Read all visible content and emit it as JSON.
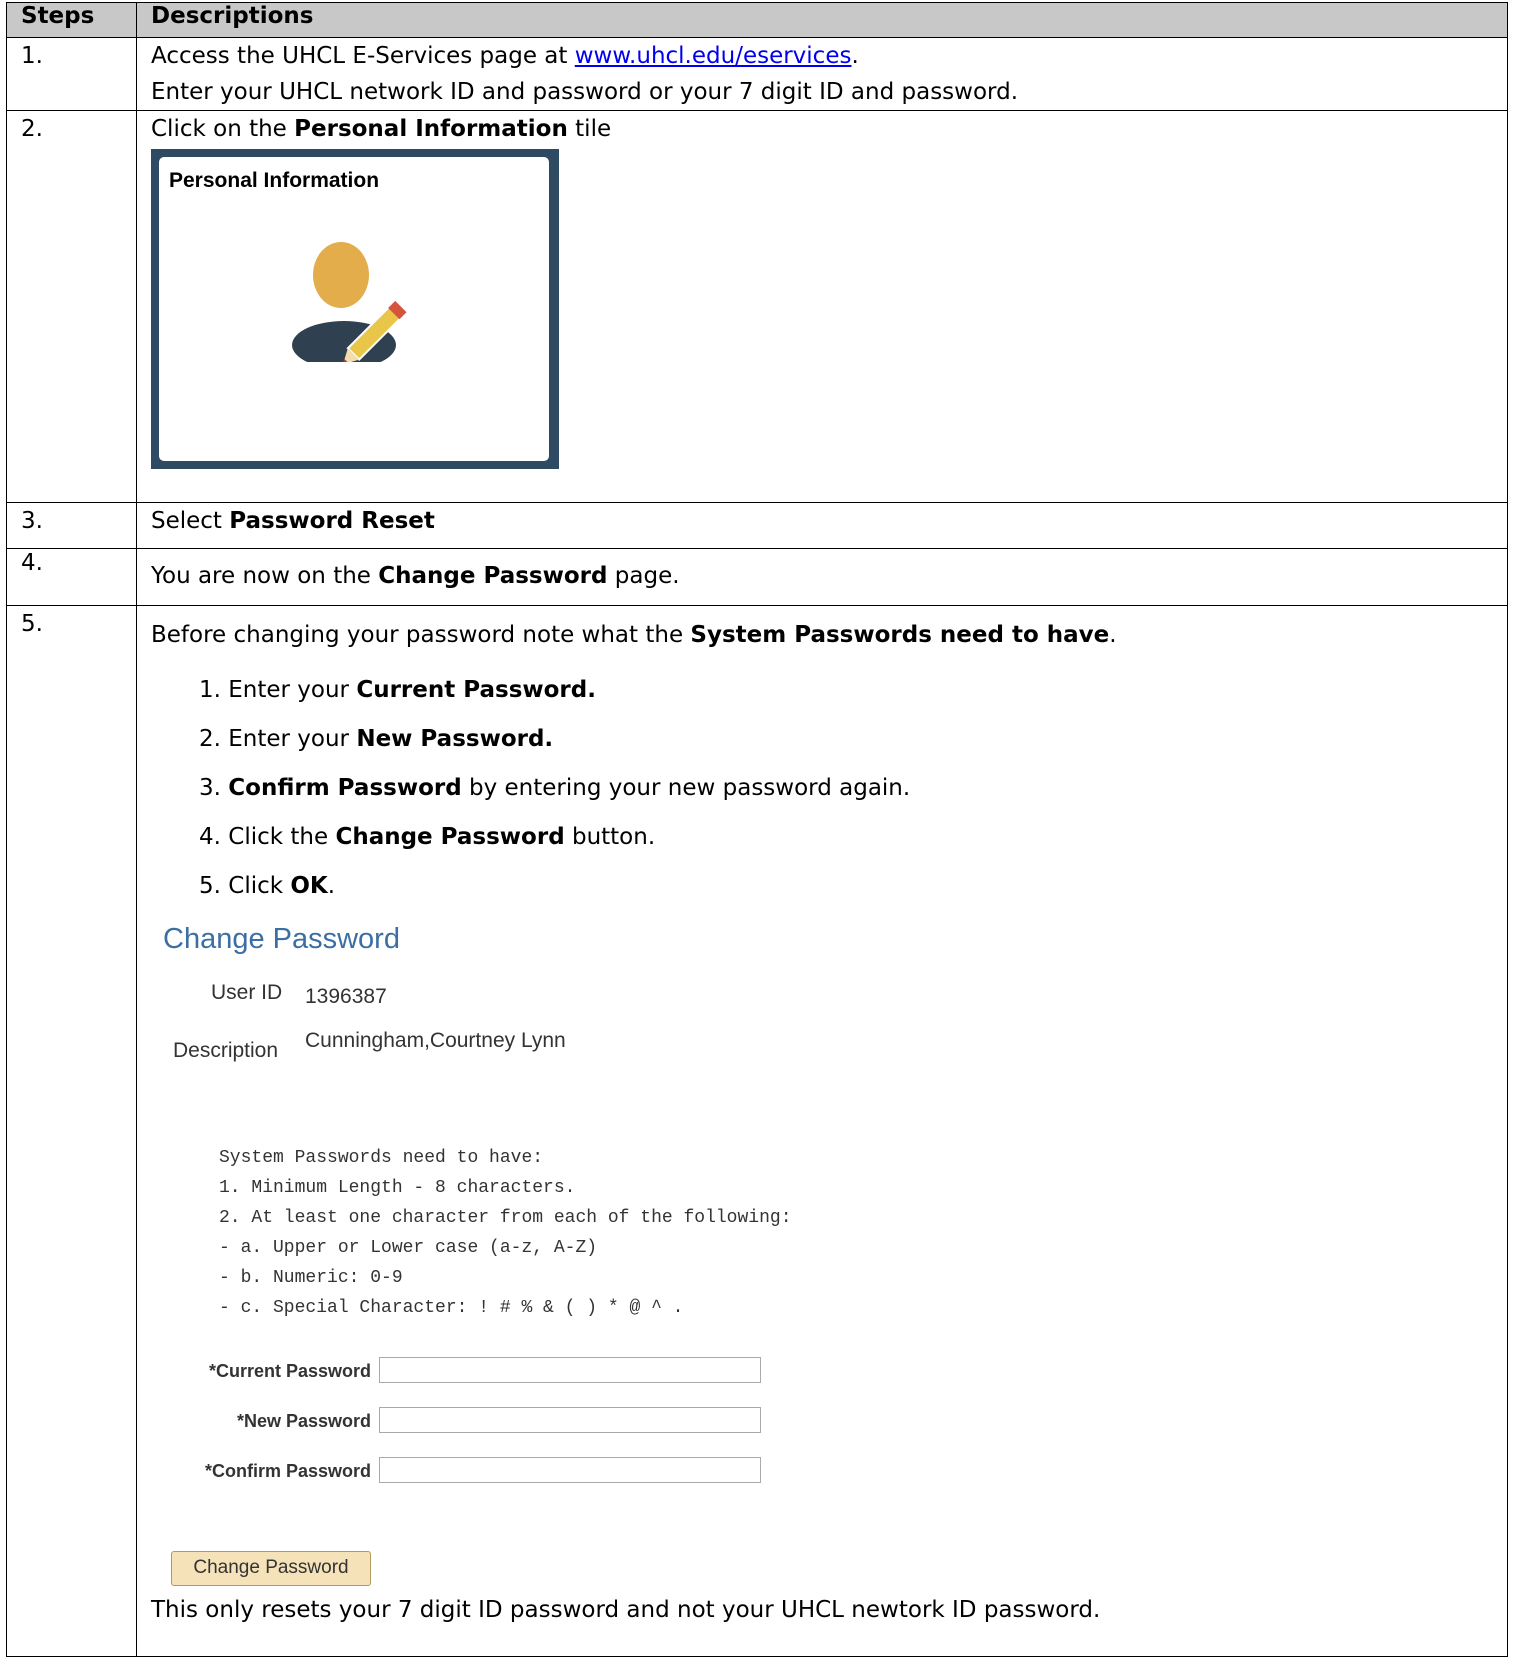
{
  "header": {
    "steps": "Steps",
    "descriptions": "Descriptions"
  },
  "step1": {
    "num": "1.",
    "line1_pre": "Access the UHCL E-Services page at ",
    "link": "www.uhcl.edu/eservices",
    "line1_post": ".",
    "line2": "Enter your UHCL network ID and password or your 7 digit ID and password."
  },
  "step2": {
    "num": "2.",
    "pre": "Click on the ",
    "bold": "Personal Information",
    "post": " tile",
    "tile_title": "Personal Information",
    "tile_icon": "person-edit-icon"
  },
  "step3": {
    "num": "3.",
    "pre": "Select ",
    "bold": "Password Reset"
  },
  "step4": {
    "num": "4.",
    "pre": "You are now on the ",
    "bold": "Change Password",
    "post": " page."
  },
  "step5": {
    "num": "5.",
    "intro_pre": "Before changing your password note what the ",
    "intro_bold": "System Passwords need to have",
    "intro_post": ".",
    "substeps": [
      {
        "pre": "1.  Enter your ",
        "bold": "Current Password.",
        "post": ""
      },
      {
        "pre": "2.  Enter your ",
        "bold": "New Password.",
        "post": ""
      },
      {
        "pre": "3.  ",
        "bold": "Confirm Password",
        "post": " by entering your new password again."
      },
      {
        "pre": "4.  Click the ",
        "bold": "Change Password",
        "post": " button."
      },
      {
        "pre": "5.  Click ",
        "bold": "OK",
        "post": "."
      }
    ],
    "form": {
      "title": "Change Password",
      "user_id_label": "User ID",
      "user_id_value": "1396387",
      "description_label": "Description",
      "description_value": "Cunningham,Courtney Lynn",
      "rules": "System Passwords need to have:\n1. Minimum Length - 8 characters.\n2. At least one character from each of the following:\n- a. Upper or Lower case (a-z, A-Z)\n- b. Numeric: 0-9\n- c. Special Character: ! # % & ( ) * @ ^ .",
      "current_password_label": "*Current Password",
      "new_password_label": "*New Password",
      "confirm_password_label": "*Confirm Password",
      "button_label": "Change Password"
    },
    "note": "This only resets your 7 digit ID password and not your UHCL newtork ID password."
  },
  "colors": {
    "header_bg": "#c8c8c8",
    "tile_border": "#2f4a63",
    "link": "#0000ee",
    "form_title": "#3b6fa3",
    "button_bg": "#f5e2b8"
  }
}
